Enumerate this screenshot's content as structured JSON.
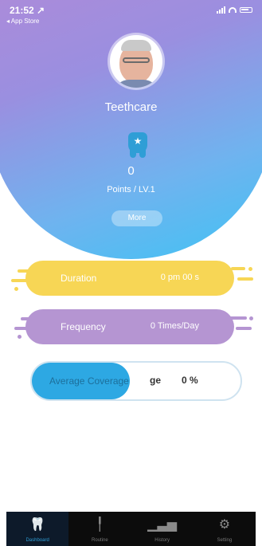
{
  "status_bar": {
    "time": "21:52 ↗",
    "back": "◂ App Store"
  },
  "profile": {
    "app_name": "Teethcare",
    "points": "0",
    "points_label": "Points / LV.1",
    "more_label": "More"
  },
  "stats": {
    "duration_label": "Duration",
    "duration_value": "0 pm 00 s",
    "frequency_label": "Frequency",
    "frequency_value": "0 Times/Day",
    "coverage_label": "Average Coverage",
    "coverage_label_end": "ge",
    "coverage_value": "0 %",
    "coverage_fill_fraction": 0.47
  },
  "tabs": [
    {
      "label": "Dashboard",
      "icon": "tooth-icon",
      "glyph": "🦷",
      "active": true
    },
    {
      "label": "Routine",
      "icon": "brush-icon",
      "glyph": "╿",
      "active": false
    },
    {
      "label": "History",
      "icon": "bar-chart-icon",
      "glyph": "▁▃▅",
      "active": false
    },
    {
      "label": "Setting",
      "icon": "gear-icon",
      "glyph": "⚙",
      "active": false
    }
  ],
  "colors": {
    "duration": "#f7d655",
    "frequency": "#b595d2",
    "coverage": "#2da8e3",
    "accent": "#2f9ed6"
  }
}
